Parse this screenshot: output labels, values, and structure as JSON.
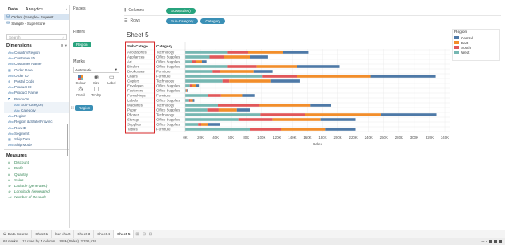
{
  "datapane": {
    "tabs": [
      "Data",
      "Analytics"
    ],
    "sources": [
      "Orders (Sample - Superst...",
      "Sample - Superstore"
    ],
    "search_placeholder": "Search",
    "dimensions_title": "Dimensions",
    "dimensions": [
      {
        "label": "Country/Region",
        "type": "Abc",
        "italic": false
      },
      {
        "label": "Customer ID",
        "type": "Abc",
        "italic": false
      },
      {
        "label": "Customer Name",
        "type": "Abc",
        "italic": false
      },
      {
        "label": "Order Date",
        "type": "▦",
        "italic": false
      },
      {
        "label": "Order ID",
        "type": "Abc",
        "italic": false
      },
      {
        "label": "Postal Code",
        "type": "⊕",
        "italic": false
      },
      {
        "label": "Product ID",
        "type": "Abc",
        "italic": false
      },
      {
        "label": "Product Name",
        "type": "Abc",
        "italic": false
      },
      {
        "label": "Products",
        "type": "⧉",
        "italic": false
      },
      {
        "label": "Sub-Category",
        "type": "Abc",
        "italic": false
      },
      {
        "label": "Category",
        "type": "Abc",
        "italic": false
      },
      {
        "label": "Region",
        "type": "Abc",
        "italic": false
      },
      {
        "label": "Region & State/Provinc",
        "type": "Abc",
        "italic": false
      },
      {
        "label": "Row ID",
        "type": "Abc",
        "italic": false
      },
      {
        "label": "Segment",
        "type": "Abc",
        "italic": false
      },
      {
        "label": "Ship Date",
        "type": "▦",
        "italic": false
      },
      {
        "label": "Ship Mode",
        "type": "Abc",
        "italic": false
      }
    ],
    "measures_title": "Measures",
    "measures": [
      {
        "label": "Discount",
        "type": "#",
        "italic": false
      },
      {
        "label": "Profit",
        "type": "#",
        "italic": false
      },
      {
        "label": "Quantity",
        "type": "#",
        "italic": false
      },
      {
        "label": "Sales",
        "type": "#",
        "italic": false
      },
      {
        "label": "Latitude (generated)",
        "type": "⊕",
        "italic": true
      },
      {
        "label": "Longitude (generated)",
        "type": "⊕",
        "italic": true
      },
      {
        "label": "Number of Records",
        "type": "=#",
        "italic": true
      }
    ]
  },
  "cards": {
    "pages_title": "Pages",
    "filters_title": "Filters",
    "filter_pill": "Region",
    "marks_title": "Marks",
    "marks_type": "Automatic",
    "mark_buttons": [
      "Colour",
      "Size",
      "Label",
      "Detail",
      "Tooltip"
    ],
    "marks_pill": "Region"
  },
  "shelves": {
    "columns_label": "Columns",
    "rows_label": "Rows",
    "columns_pills": [
      "SUM(Sales)"
    ],
    "rows_pills": [
      "Sub-Category",
      "Category"
    ]
  },
  "sheet_title": "Sheet 5",
  "legend": {
    "title": "Region",
    "items": [
      {
        "label": "Central",
        "color": "#4e79a7"
      },
      {
        "label": "East",
        "color": "#f28e2b"
      },
      {
        "label": "South",
        "color": "#e15759"
      },
      {
        "label": "West",
        "color": "#76b7b2"
      }
    ]
  },
  "chart_data": {
    "type": "bar",
    "orientation": "horizontal",
    "stacked": true,
    "row_headers": [
      "Sub-Catego..",
      "Category"
    ],
    "categories": [
      "Accessories",
      "Appliances",
      "Art",
      "Binders",
      "Bookcases",
      "Chairs",
      "Copiers",
      "Envelopes",
      "Fasteners",
      "Furnishings",
      "Labels",
      "Machines",
      "Paper",
      "Phones",
      "Storage",
      "Supplies",
      "Tables"
    ],
    "category_group": [
      "Technology",
      "Office Supplies",
      "Office Supplies",
      "Office Supplies",
      "Furniture",
      "Furniture",
      "Technology",
      "Office Supplies",
      "Office Supplies",
      "Furniture",
      "Office Supplies",
      "Technology",
      "Office Supplies",
      "Technology",
      "Office Supplies",
      "Office Supplies",
      "Furniture"
    ],
    "series": [
      {
        "name": "West",
        "color": "#76b7b2",
        "values": [
          55000,
          32000,
          9000,
          55000,
          36000,
          101000,
          49000,
          6000,
          1000,
          30000,
          5000,
          43000,
          29000,
          98000,
          70000,
          17000,
          85000
        ]
      },
      {
        "name": "South",
        "color": "#e15759",
        "values": [
          27000,
          19000,
          5000,
          38000,
          10000,
          45000,
          9000,
          3000,
          500,
          17000,
          2000,
          54000,
          15000,
          59000,
          44000,
          4000,
          40000
        ]
      },
      {
        "name": "East",
        "color": "#f28e2b",
        "values": [
          46000,
          34000,
          8000,
          53000,
          44000,
          97000,
          54000,
          5000,
          800,
          28000,
          3000,
          67000,
          24000,
          99000,
          63000,
          9000,
          59000
        ]
      },
      {
        "name": "Central",
        "color": "#4e79a7",
        "values": [
          33000,
          23000,
          6000,
          56000,
          24000,
          85000,
          38000,
          4000,
          800,
          16000,
          2000,
          27000,
          17000,
          73000,
          46000,
          16000,
          39000
        ]
      }
    ],
    "xlabel": "Sales",
    "xlim": [
      0,
      240000
    ],
    "x_ticks": [
      "0K",
      "20K",
      "40K",
      "60K",
      "80K",
      "100K",
      "120K",
      "140K",
      "160K",
      "180K",
      "200K",
      "220K",
      "240K",
      "260K",
      "280K",
      "300K",
      "320K",
      "340K"
    ]
  },
  "sheet_tabs": {
    "datasource": "Data Source",
    "tabs": [
      "Sheet 1",
      "bar chart",
      "Sheet 3",
      "Sheet 4",
      "Sheet 5"
    ],
    "active": "Sheet 5"
  },
  "status": {
    "marks": "68 marks",
    "rows_cols": "17 rows by 1 column",
    "sum": "SUM(Sales): 2,326,534"
  }
}
